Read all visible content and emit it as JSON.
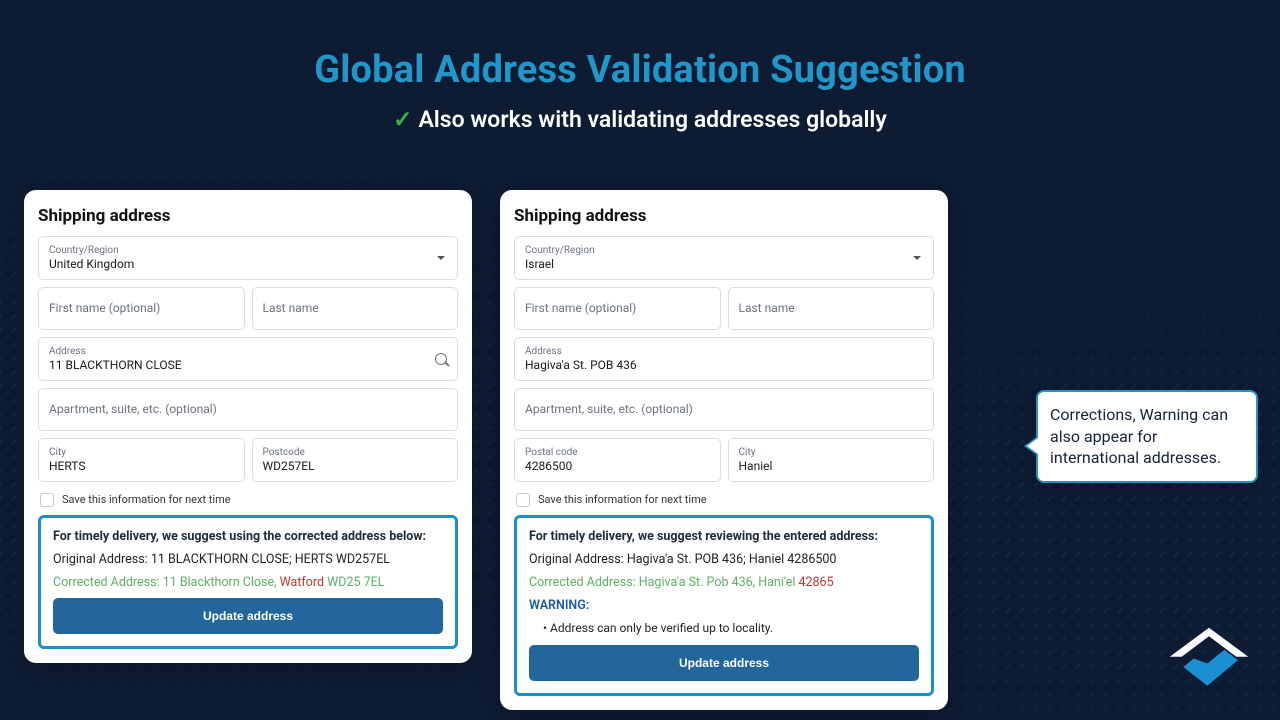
{
  "header": {
    "title": "Global Address Validation Suggestion",
    "subtitle": "Also works with validating addresses globally"
  },
  "callout": {
    "text": "Corrections, Warning can also appear for international addresses."
  },
  "labels": {
    "shipping": "Shipping address",
    "country": "Country/Region",
    "first_name_ph": "First name (optional)",
    "last_name_ph": "Last name",
    "address": "Address",
    "apartment_ph": "Apartment, suite, etc. (optional)",
    "city": "City",
    "postcode": "Postcode",
    "postal_code": "Postal code",
    "save": "Save this information for next time",
    "update_btn": "Update address",
    "original": "Original Address:",
    "corrected": "Corrected Address:",
    "warning": "WARNING:"
  },
  "leftForm": {
    "country": "United Kingdom",
    "address": "11 BLACKTHORN CLOSE",
    "city": "HERTS",
    "postcode": "WD257EL",
    "suggest_head": "For timely delivery, we suggest using the corrected address below:",
    "original_value": "11 BLACKTHORN CLOSE; HERTS WD257EL",
    "corrected_prefix": "11 Blackthorn Close, ",
    "corrected_added": "Watford",
    "corrected_suffix": " WD25 7EL"
  },
  "rightForm": {
    "country": "Israel",
    "address": "Hagiva'a St. POB 436",
    "postal_code": "4286500",
    "city": "Haniel",
    "suggest_head": "For timely delivery, we suggest reviewing the entered address:",
    "original_value": "Hagiva'a St. POB 436; Haniel 4286500",
    "corrected_prefix": "Hagiva'a St. Pob 436, Hani'el ",
    "corrected_added": "42865",
    "warning_bullet": "Address can only be verified up to locality."
  }
}
